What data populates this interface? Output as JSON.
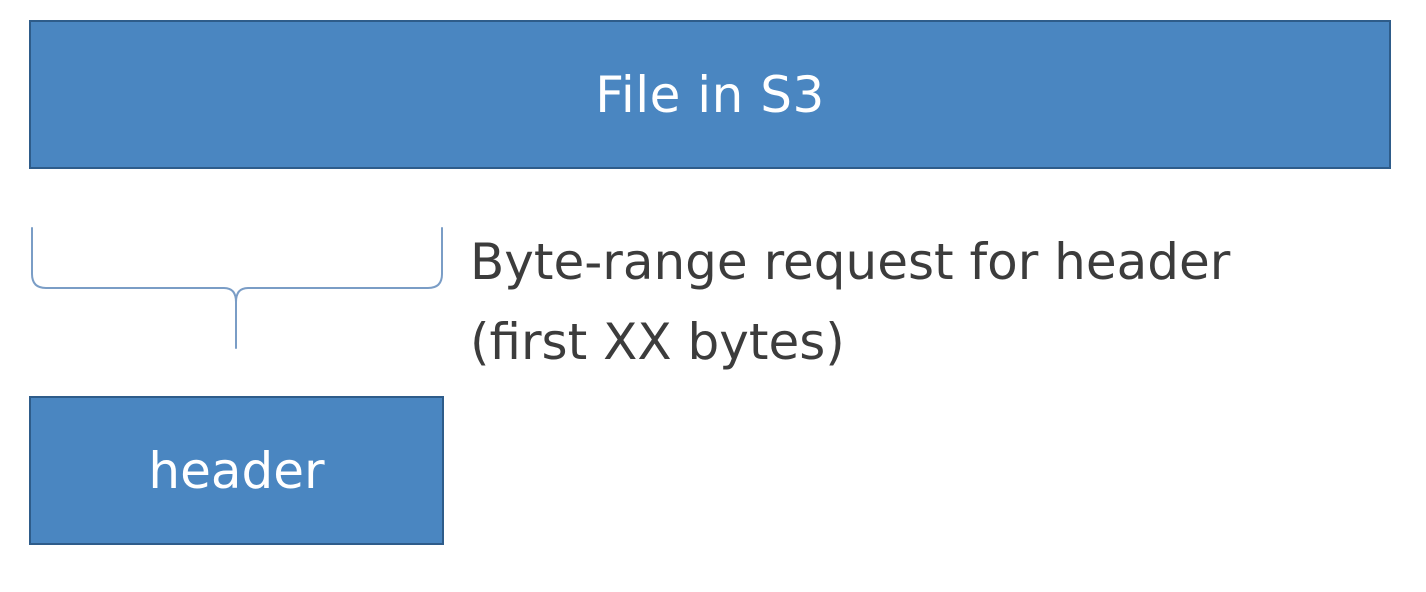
{
  "colors": {
    "box_fill": "#4A86C1",
    "box_border": "#2E5C8A",
    "box_text": "#FFFFFF",
    "brace": "#7A9DC6",
    "callout_text": "#3C3C3C"
  },
  "file_box": {
    "label": "File in S3"
  },
  "header_box": {
    "label": "header"
  },
  "brace": {
    "icon": "curly-brace-down-icon"
  },
  "callout": {
    "line1": "Byte-range request for header",
    "line2": "(first XX bytes)"
  }
}
